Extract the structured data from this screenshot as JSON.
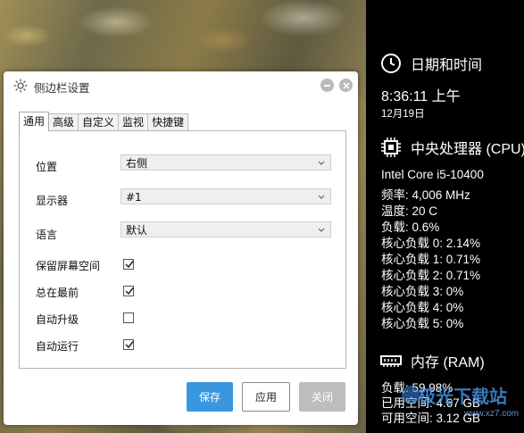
{
  "dialog": {
    "title": "侧边栏设置",
    "tabs": [
      "通用",
      "高级",
      "自定义",
      "监视",
      "快捷键"
    ],
    "active_tab": 0,
    "fields": {
      "position_label": "位置",
      "position_value": "右侧",
      "display_label": "显示器",
      "display_value": "#1",
      "language_label": "语言",
      "language_value": "默认"
    },
    "checkboxes": [
      {
        "label": "保留屏幕空间",
        "checked": true
      },
      {
        "label": "总在最前",
        "checked": true
      },
      {
        "label": "自动升级",
        "checked": false
      },
      {
        "label": "自动运行",
        "checked": true
      }
    ],
    "buttons": {
      "save": "保存",
      "apply": "应用",
      "close": "关闭"
    }
  },
  "sidebar": {
    "datetime": {
      "header": "日期和时间",
      "time": "8:36:11 上午",
      "date": "12月19日"
    },
    "cpu": {
      "header": "中央处理器 (CPU)",
      "model": "Intel Core i5-10400",
      "frequency": "频率: 4,006 MHz",
      "temperature": "温度: 20 C",
      "load": "负载: 0.6%",
      "cores": [
        "核心负载 0: 2.14%",
        "核心负载 1: 0.71%",
        "核心负载 2: 0.71%",
        "核心负载 3: 0%",
        "核心负载 4: 0%",
        "核心负载 5: 0%"
      ]
    },
    "ram": {
      "header": "内存 (RAM)",
      "load": "负载: 59.98%",
      "used": "已用空间: 4.67 GB",
      "free": "可用空间: 3.12 GB"
    },
    "watermark": "极光下载站",
    "watermark_sub": "www.xz7.com"
  },
  "colors": {
    "accent": "#3897e0",
    "sidebar_bg": "#000000",
    "disabled": "#bdbdbd"
  },
  "icons": [
    "gear-icon",
    "minimize-icon",
    "close-icon",
    "clock-icon",
    "cpu-icon",
    "ram-icon",
    "chevron-down-icon",
    "checkmark-icon"
  ]
}
